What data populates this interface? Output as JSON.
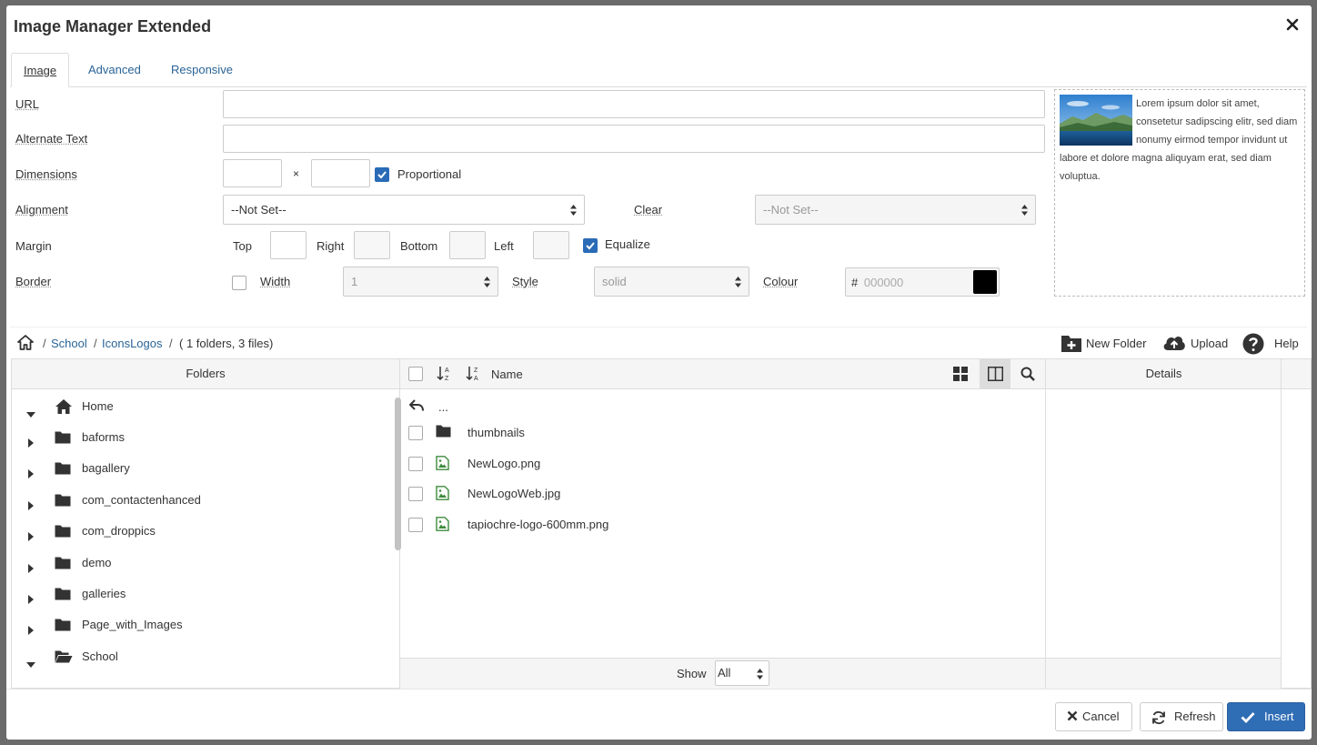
{
  "modal": {
    "title": "Image Manager Extended"
  },
  "tabs": [
    {
      "label": "Image",
      "active": true
    },
    {
      "label": "Advanced",
      "active": false
    },
    {
      "label": "Responsive",
      "active": false
    }
  ],
  "form": {
    "url_label": "URL",
    "url_value": "",
    "alt_label": "Alternate Text",
    "alt_value": "",
    "dimensions_label": "Dimensions",
    "width_value": "",
    "height_value": "",
    "times": "×",
    "proportional_label": "Proportional",
    "proportional_checked": true,
    "alignment_label": "Alignment",
    "alignment_value": "--Not Set--",
    "clear_label": "Clear",
    "clear_value": "--Not Set--",
    "margin_label": "Margin",
    "margin_top_label": "Top",
    "margin_right_label": "Right",
    "margin_bottom_label": "Bottom",
    "margin_left_label": "Left",
    "equalize_label": "Equalize",
    "equalize_checked": true,
    "border_label": "Border",
    "border_checked": false,
    "border_width_label": "Width",
    "border_width_value": "1",
    "border_style_label": "Style",
    "border_style_value": "solid",
    "border_colour_label": "Colour",
    "border_colour_hash": "#",
    "border_colour_placeholder": "000000",
    "border_colour_swatch": "#000000"
  },
  "preview": {
    "text": "Lorem ipsum dolor sit amet, consetetur sadipscing elitr, sed diam nonumy eirmod tempor invidunt ut labore et dolore magna aliquyam erat, sed diam voluptua."
  },
  "breadcrumb": {
    "sep": "/",
    "items": [
      "School",
      "IconsLogos"
    ],
    "summary": "( 1 folders, 3 files)"
  },
  "toolbar": {
    "new_folder": "New Folder",
    "upload": "Upload",
    "help": "Help"
  },
  "folders": {
    "header": "Folders",
    "items": [
      {
        "label": "Home",
        "expanded": true,
        "icon": "home-icon"
      },
      {
        "label": "baforms",
        "expanded": false,
        "icon": "folder-icon"
      },
      {
        "label": "bagallery",
        "expanded": false,
        "icon": "folder-icon"
      },
      {
        "label": "com_contactenhanced",
        "expanded": false,
        "icon": "folder-icon"
      },
      {
        "label": "com_droppics",
        "expanded": false,
        "icon": "folder-icon"
      },
      {
        "label": "demo",
        "expanded": false,
        "icon": "folder-icon"
      },
      {
        "label": "galleries",
        "expanded": false,
        "icon": "folder-icon"
      },
      {
        "label": "Page_with_Images",
        "expanded": false,
        "icon": "folder-icon"
      },
      {
        "label": "School",
        "expanded": true,
        "icon": "folder-open-icon"
      }
    ]
  },
  "files": {
    "name_header": "Name",
    "up_label": "...",
    "items": [
      {
        "label": "thumbnails",
        "type": "folder"
      },
      {
        "label": "NewLogo.png",
        "type": "image"
      },
      {
        "label": "NewLogoWeb.jpg",
        "type": "image"
      },
      {
        "label": "tapiochre-logo-600mm.png",
        "type": "image"
      }
    ],
    "show_label": "Show",
    "show_value": "All"
  },
  "details": {
    "header": "Details"
  },
  "buttons": {
    "cancel": "Cancel",
    "refresh": "Refresh",
    "insert": "Insert"
  },
  "colors": {
    "link": "#2a6496",
    "primary": "#2f6db5",
    "image_icon": "#3d8b3d"
  }
}
